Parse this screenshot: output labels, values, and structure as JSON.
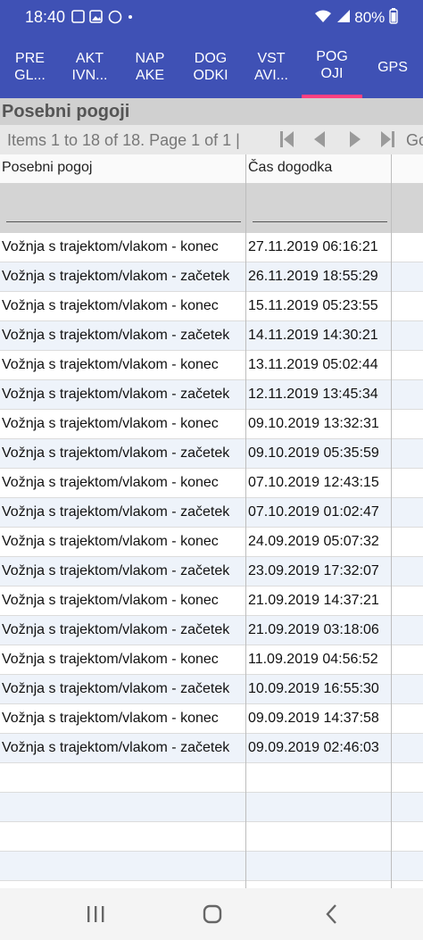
{
  "status_bar": {
    "time": "18:40",
    "battery": "80%"
  },
  "tabs": [
    {
      "label": "PRE\nGL..."
    },
    {
      "label": "AKT\nIVN..."
    },
    {
      "label": "NAP\nAKE"
    },
    {
      "label": "DOG\nODKI"
    },
    {
      "label": "VST\nAVI..."
    },
    {
      "label": "POG\nOJI"
    },
    {
      "label": "GPS"
    }
  ],
  "active_tab": 5,
  "section_title": "Posebni pogoji",
  "pager": {
    "info": "Items 1 to 18 of 18. Page 1 of 1 |",
    "go_label": "Go"
  },
  "columns": {
    "condition": "Posebni pogoj",
    "time": "Čas dogodka"
  },
  "rows": [
    {
      "condition": "Vožnja s trajektom/vlakom - konec",
      "time": "27.11.2019 06:16:21"
    },
    {
      "condition": "Vožnja s trajektom/vlakom - začetek",
      "time": "26.11.2019 18:55:29"
    },
    {
      "condition": "Vožnja s trajektom/vlakom - konec",
      "time": "15.11.2019 05:23:55"
    },
    {
      "condition": "Vožnja s trajektom/vlakom - začetek",
      "time": "14.11.2019 14:30:21"
    },
    {
      "condition": "Vožnja s trajektom/vlakom - konec",
      "time": "13.11.2019 05:02:44"
    },
    {
      "condition": "Vožnja s trajektom/vlakom - začetek",
      "time": "12.11.2019 13:45:34"
    },
    {
      "condition": "Vožnja s trajektom/vlakom - konec",
      "time": "09.10.2019 13:32:31"
    },
    {
      "condition": "Vožnja s trajektom/vlakom - začetek",
      "time": "09.10.2019 05:35:59"
    },
    {
      "condition": "Vožnja s trajektom/vlakom - konec",
      "time": "07.10.2019 12:43:15"
    },
    {
      "condition": "Vožnja s trajektom/vlakom - začetek",
      "time": "07.10.2019 01:02:47"
    },
    {
      "condition": "Vožnja s trajektom/vlakom - konec",
      "time": "24.09.2019 05:07:32"
    },
    {
      "condition": "Vožnja s trajektom/vlakom - začetek",
      "time": "23.09.2019 17:32:07"
    },
    {
      "condition": "Vožnja s trajektom/vlakom - konec",
      "time": "21.09.2019 14:37:21"
    },
    {
      "condition": "Vožnja s trajektom/vlakom - začetek",
      "time": "21.09.2019 03:18:06"
    },
    {
      "condition": "Vožnja s trajektom/vlakom - konec",
      "time": "11.09.2019 04:56:52"
    },
    {
      "condition": "Vožnja s trajektom/vlakom - začetek",
      "time": "10.09.2019 16:55:30"
    },
    {
      "condition": "Vožnja s trajektom/vlakom - konec",
      "time": "09.09.2019 14:37:58"
    },
    {
      "condition": "Vožnja s trajektom/vlakom - začetek",
      "time": "09.09.2019 02:46:03"
    }
  ],
  "empty_rows": 5,
  "colors": {
    "app_bar": "#3f51b5",
    "active_tab_indicator": "#ff4081",
    "alt_row": "#eef3fa"
  },
  "icons": {
    "pager": [
      "first-page-icon",
      "prev-page-icon",
      "next-page-icon",
      "last-page-icon"
    ],
    "nav": [
      "recent-apps-icon",
      "home-icon",
      "back-icon"
    ]
  }
}
